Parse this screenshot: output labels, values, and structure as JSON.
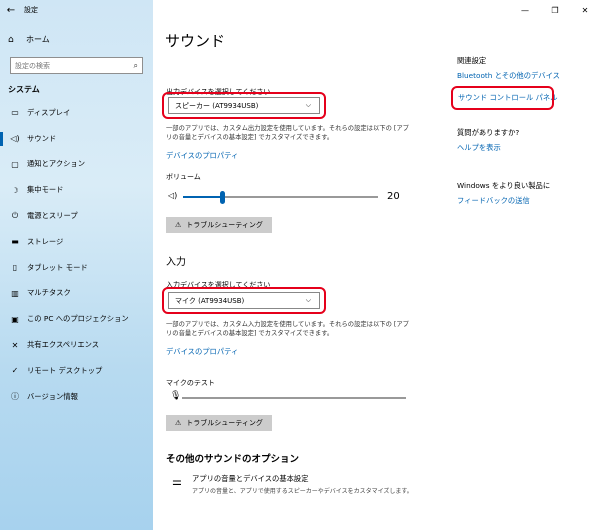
{
  "window": {
    "title": "設定",
    "back_glyph": "←",
    "minimize_glyph": "—",
    "maximize_glyph": "❐",
    "close_glyph": "✕"
  },
  "sidebar": {
    "home_label": "ホーム",
    "search_placeholder": "設定の検索",
    "section": "システム",
    "items": [
      {
        "label": "ディスプレイ",
        "icon": "display-icon",
        "glyph": "▭"
      },
      {
        "label": "サウンド",
        "icon": "speaker-icon",
        "glyph": "◁)"
      },
      {
        "label": "通知とアクション",
        "icon": "notification-icon",
        "glyph": "▢"
      },
      {
        "label": "集中モード",
        "icon": "moon-icon",
        "glyph": "☽"
      },
      {
        "label": "電源とスリープ",
        "icon": "power-icon",
        "glyph": "⏻"
      },
      {
        "label": "ストレージ",
        "icon": "storage-icon",
        "glyph": "▬"
      },
      {
        "label": "タブレット モード",
        "icon": "tablet-icon",
        "glyph": "▯"
      },
      {
        "label": "マルチタスク",
        "icon": "multitask-icon",
        "glyph": "▥"
      },
      {
        "label": "この PC へのプロジェクション",
        "icon": "projection-icon",
        "glyph": "▣"
      },
      {
        "label": "共有エクスペリエンス",
        "icon": "share-icon",
        "glyph": "✕"
      },
      {
        "label": "リモート デスクトップ",
        "icon": "remote-icon",
        "glyph": "✓"
      },
      {
        "label": "バージョン情報",
        "icon": "info-icon",
        "glyph": "ⓘ"
      }
    ],
    "active_index": 1
  },
  "main": {
    "title": "サウンド",
    "output": {
      "label": "出力デバイスを選択してください",
      "selected": "スピーカー (AT9934USB)",
      "description": "一部のアプリでは、カスタム出力設定を使用しています。それらの設定は以下の [アプリの音量とデバイスの基本設定] でカスタマイズできます。",
      "properties_link": "デバイスのプロパティ",
      "volume_label": "ボリューム",
      "volume_value": "20",
      "volume_fraction": 0.2,
      "troubleshoot": "トラブルシューティング"
    },
    "input": {
      "heading": "入力",
      "label": "入力デバイスを選択してください",
      "selected": "マイク (AT9934USB)",
      "description": "一部のアプリでは、カスタム入力設定を使用しています。それらの設定は以下の [アプリの音量とデバイスの基本設定] でカスタマイズできます。",
      "properties_link": "デバイスのプロパティ",
      "mic_test_label": "マイクのテスト",
      "troubleshoot": "トラブルシューティング"
    },
    "other": {
      "heading": "その他のサウンドのオプション",
      "app_volume_title": "アプリの音量とデバイスの基本設定",
      "app_volume_desc": "アプリの音量と、アプリで使用するスピーカーやデバイスをカスタマイズします。"
    }
  },
  "right": {
    "related_heading": "関連設定",
    "bluetooth_link": "Bluetooth とその他のデバイス",
    "sound_panel_link": "サウンド コントロール パネル",
    "question_heading": "質問がありますか?",
    "help_link": "ヘルプを表示",
    "improve_heading": "Windows をより良い製品に",
    "feedback_link": "フィードバックの送信"
  },
  "colors": {
    "accent": "#0063b1",
    "highlight_ring": "#e5001b"
  }
}
